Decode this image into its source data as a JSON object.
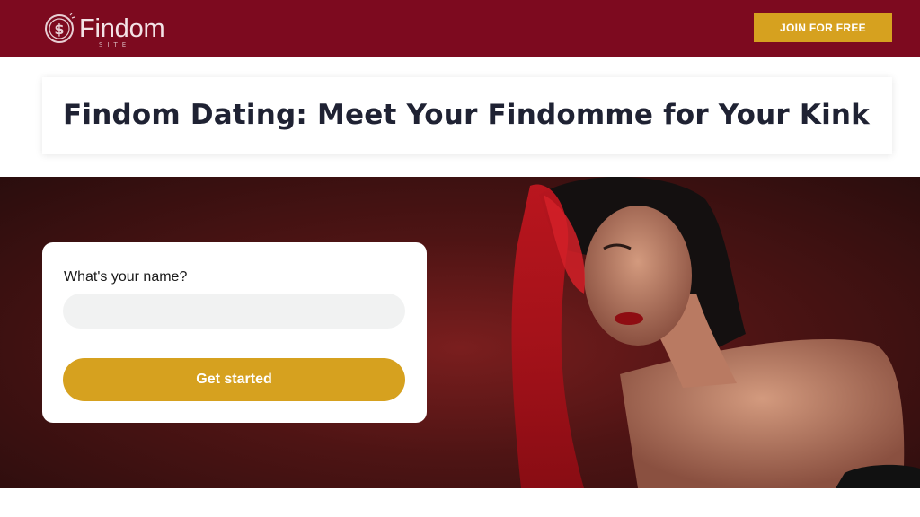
{
  "header": {
    "brand_name": "Findom",
    "brand_sub": "SITE",
    "join_label": "JOIN FOR FREE"
  },
  "main": {
    "title": "Findom Dating: Meet Your Findomme for Your Kink"
  },
  "form": {
    "name_label": "What's your name?",
    "name_value": "",
    "submit_label": "Get started"
  },
  "colors": {
    "header_bg": "#7d0a1f",
    "accent_gold": "#d6a11f",
    "title_text": "#1f2233",
    "hero_bg": "#4e1414"
  },
  "icons": {
    "logo": "dollar-coin-icon"
  }
}
